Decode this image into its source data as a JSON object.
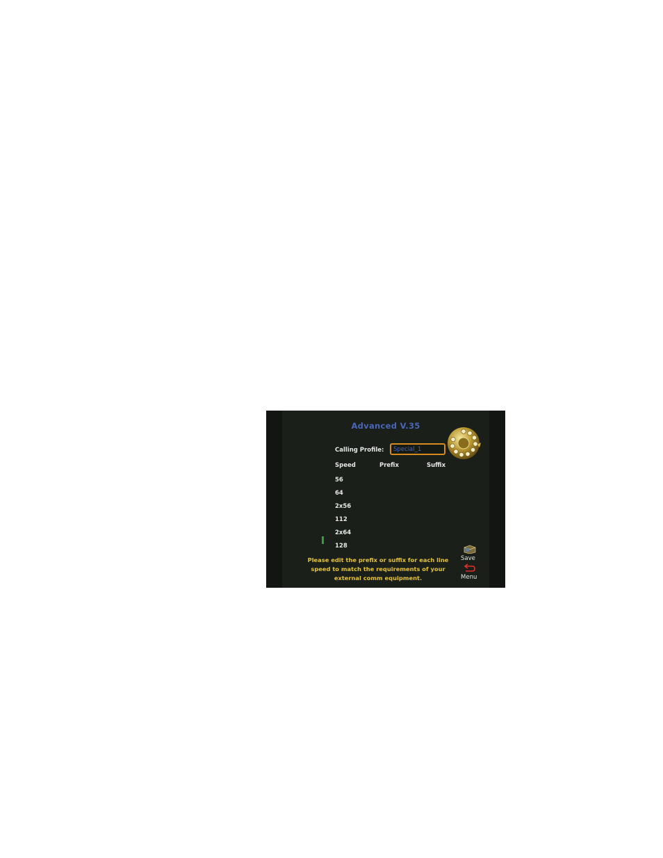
{
  "screen": {
    "title": "Advanced V.35",
    "calling_profile_label": "Calling Profile:",
    "calling_profile_value": "Special_1",
    "columns": {
      "speed": "Speed",
      "prefix": "Prefix",
      "suffix": "Suffix"
    },
    "speeds": [
      "56",
      "64",
      "2x56",
      "112",
      "2x64",
      "128"
    ],
    "note": "Please edit the prefix or suffix for each line speed to match the requirements of your external comm equipment.",
    "actions": {
      "save": "Save",
      "menu": "Menu"
    },
    "colors": {
      "background": "#121512",
      "title": "#4a66b8",
      "field_border": "#d98a1e",
      "note_text": "#e3c23a",
      "scroll_indicator": "#2fa13a"
    },
    "icons": {
      "dial": "rotary-dial-icon",
      "save": "save-box-icon",
      "menu": "return-arrow-icon"
    }
  }
}
